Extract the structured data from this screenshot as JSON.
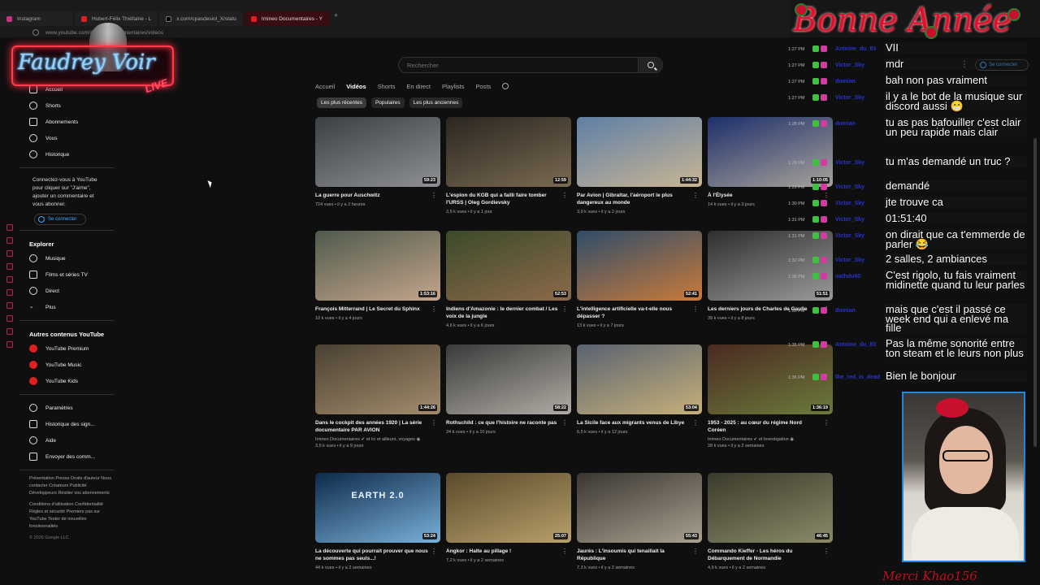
{
  "browser": {
    "tabs": [
      {
        "label": "Instagram",
        "icon": "instagram-icon"
      },
      {
        "label": "Hubert-Félix Thiéfaine - L",
        "icon": "youtube-icon"
      },
      {
        "label": "x.com/cpasdesiol_X/statu",
        "icon": "x-icon"
      },
      {
        "label": "Imineo Documentaires - Y",
        "icon": "youtube-icon"
      }
    ],
    "url": "www.youtube.com/@ImineoDocumentaires/videos"
  },
  "overlay": {
    "logo_text": "Faudrey Voir",
    "logo_live": "LIVE",
    "banner": "Bonne Année",
    "footer_text": "Merci Khao156"
  },
  "chat": [
    {
      "time": "1:27 PM",
      "user": "Antoine_du_83",
      "msg": "VII"
    },
    {
      "time": "1:27 PM",
      "user": "Victor_Sky",
      "msg": "mdr"
    },
    {
      "time": "1:27 PM",
      "user": "domian",
      "msg": "bah non pas vraiment"
    },
    {
      "time": "1:27 PM",
      "user": "Victor_Sky",
      "msg": "il y a le bot de la musique sur discord aussi 😁"
    },
    {
      "time": "1:28 PM",
      "user": "domian",
      "msg": "tu as pas bafouiller c'est clair un peu rapide mais clair"
    },
    {
      "time": "1:29 PM",
      "user": "Victor_Sky",
      "msg": "tu m'as demandé un truc ?"
    },
    {
      "time": "1:29 PM",
      "user": "Victor_Sky",
      "msg": "demandé"
    },
    {
      "time": "1:30 PM",
      "user": "Victor_Sky",
      "msg": "jte trouve ca"
    },
    {
      "time": "1:31 PM",
      "user": "Victor_Sky",
      "msg": "01:51:40"
    },
    {
      "time": "1:31 PM",
      "user": "Victor_Sky",
      "msg": "on dirait que ca t'emmerde de parler 😂"
    },
    {
      "time": "1:32 PM",
      "user": "Victor_Sky",
      "msg": "2 salles, 2 ambiances"
    },
    {
      "time": "1:35 PM",
      "user": "nathdu60",
      "msg": "C'est rigolo, tu fais vraiment midinette quand tu leur parles"
    },
    {
      "time": "1:35 PM",
      "user": "domian",
      "msg": "mais que c'est il passé ce week end qui a enlevé ma fille"
    },
    {
      "time": "1:35 PM",
      "user": "Antoine_du_83",
      "msg": "Pas la même sonorité entre ton steam et le leurs non plus"
    },
    {
      "time": "1:36 PM",
      "user": "the_red_is_dead",
      "msg": "Bien le bonjour"
    }
  ],
  "nav": {
    "items": [
      {
        "label": "Accueil",
        "icon": "home-icon"
      },
      {
        "label": "Shorts",
        "icon": "shorts-icon"
      },
      {
        "label": "Abonnements",
        "icon": "subscriptions-icon"
      },
      {
        "label": "Vous",
        "icon": "account-icon"
      },
      {
        "label": "Historique",
        "icon": "history-icon"
      }
    ],
    "signin_prompt": "Connectez-vous à YouTube pour cliquer sur \"J'aime\", ajouter un commentaire et vous abonner.",
    "signin_label": "Se connecter",
    "explore_title": "Explorer",
    "explore": [
      {
        "label": "Musique",
        "icon": "music-icon"
      },
      {
        "label": "Films et séries TV",
        "icon": "film-icon"
      },
      {
        "label": "Direct",
        "icon": "live-icon"
      },
      {
        "label": "Plus",
        "icon": "chevron-down-icon"
      }
    ],
    "more_title": "Autres contenus YouTube",
    "more": [
      {
        "label": "YouTube Premium",
        "icon": "youtube-premium-icon"
      },
      {
        "label": "YouTube Music",
        "icon": "youtube-music-icon"
      },
      {
        "label": "YouTube Kids",
        "icon": "youtube-kids-icon"
      }
    ],
    "settings": [
      {
        "label": "Paramètres",
        "icon": "gear-icon"
      },
      {
        "label": "Historique des sign...",
        "icon": "flag-icon"
      },
      {
        "label": "Aide",
        "icon": "help-icon"
      },
      {
        "label": "Envoyer des comm...",
        "icon": "feedback-icon"
      }
    ],
    "footer1": "Présentation  Presse  Droits d'auteur  Nous contacter  Créateurs  Publicité  Développeurs  Résilier vos abonnements",
    "footer2": "Conditions d'utilisation  Confidentialité  Règles et sécurité  Premiers pas sur YouTube  Tester de nouvelles fonctionnalités",
    "copyright": "© 2026 Google LLC"
  },
  "search": {
    "placeholder": "Rechercher"
  },
  "header_signin": "Se connecter",
  "channel_tabs": [
    "Accueil",
    "Vidéos",
    "Shorts",
    "En direct",
    "Playlists",
    "Posts"
  ],
  "chips": [
    "Les plus récentes",
    "Populaires",
    "Les plus anciennes"
  ],
  "videos": [
    {
      "title": "La guerre pour Auschwitz",
      "meta": "724 vues • il y a 2 heures",
      "dur": "59:23",
      "c1": "#3b3f44",
      "c2": "#8e9094"
    },
    {
      "title": "L'espion du KGB qui a failli faire tomber l'URSS | Oleg Gordievsky",
      "meta": "2,5 k vues • il y a 1 jour",
      "dur": "12:59",
      "c1": "#2a2620",
      "c2": "#7a6a52"
    },
    {
      "title": "Par Avion | Gibraltar, l'aéroport le plus dangereux au monde",
      "meta": "3,9 k vues • il y a 2 jours",
      "dur": "1:44:32",
      "c1": "#5e7fa6",
      "c2": "#c9b594"
    },
    {
      "title": "À l'Élysée",
      "meta": "14 k vues • il y a 3 jours",
      "dur": "1:10:05",
      "c1": "#1d2f6b",
      "c2": "#a8a29a"
    },
    {
      "title": "François Mitterrand | Le Secret du Sphinx",
      "meta": "10 k vues • il y a 4 jours",
      "dur": "1:53:16",
      "c1": "#4f5a4c",
      "c2": "#c4a58c"
    },
    {
      "title": "Indiens d'Amazonie : le dernier combat / Les voix de la jungle",
      "meta": "4,6 k vues • il y a 6 jours",
      "dur": "52:53",
      "c1": "#3b4a2a",
      "c2": "#8c6a4a"
    },
    {
      "title": "L'intelligence artificielle va-t-elle nous dépasser ?",
      "meta": "13 k vues • il y a 7 jours",
      "dur": "52:41",
      "c1": "#2f4d6a",
      "c2": "#c87a3a"
    },
    {
      "title": "Les derniers jours de Charles de Gaulle",
      "meta": "39 k vues • il y a 8 jours",
      "dur": "51:51",
      "c1": "#2e2e2e",
      "c2": "#9a9a9a"
    },
    {
      "title": "Dans le cockpit des années 1920 | La série documentaire PAR AVION",
      "meta": "Imineo Documentaires ✔ et Ici et ailleurs, voyages ◉\n3,5 k vues • il y a 9 jours",
      "dur": "1:44:26",
      "c1": "#4a4032",
      "c2": "#a28c6c"
    },
    {
      "title": "Rothschild : ce que l'histoire ne raconte pas",
      "meta": "24 k vues • il y a 10 jours",
      "dur": "58:22",
      "c1": "#3a3a3a",
      "c2": "#b0aca4"
    },
    {
      "title": "La Sicile face aux migrants venus de Libye",
      "meta": "6,5 k vues • il y a 12 jours",
      "dur": "53:04",
      "c1": "#5a6270",
      "c2": "#c6b07a"
    },
    {
      "title": "1953 - 2025 : au cœur du régime Nord Coréen",
      "meta": "Imineo Documentaires ✔ et Investigation ◉\n28 k vues • il y a 2 semaines",
      "dur": "1:36:19",
      "c1": "#4a2a22",
      "c2": "#6b7a3a"
    },
    {
      "title": "La découverte qui pourrait prouver que nous ne sommes pas seuls...!",
      "meta": "44 k vues • il y a 2 semaines",
      "dur": "53:24",
      "c1": "#0d2a4a",
      "c2": "#7ab0d8"
    },
    {
      "title": "Angkor : Halte au pillage !",
      "meta": "7,2 k vues • il y a 2 semaines",
      "dur": "25:07",
      "c1": "#5a4a2a",
      "c2": "#b8a06c"
    },
    {
      "title": "Jaurès : L'insoumis qui tenaillait la République",
      "meta": "7,3 k vues • il y a 2 semaines",
      "dur": "55:43",
      "c1": "#3a3630",
      "c2": "#a8a090"
    },
    {
      "title": "Commando Kieffer - Les héros du Débarquement de Normandie",
      "meta": "4,9 k vues • il y a 2 semaines",
      "dur": "46:45",
      "c1": "#3a3a2a",
      "c2": "#8a8a6a"
    }
  ],
  "thumb_text_earth": "EARTH 2.0"
}
